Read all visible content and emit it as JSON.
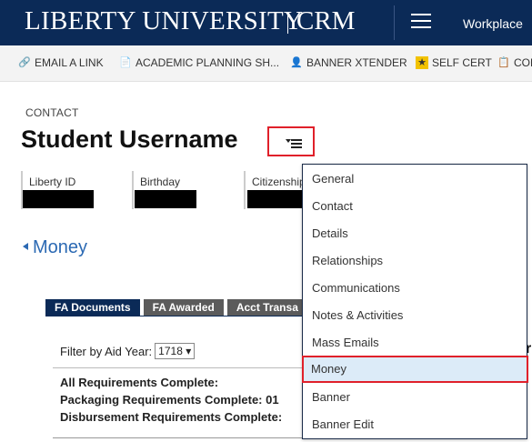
{
  "header": {
    "brand_main": "LIBERTY UNIVERSITY",
    "brand_suffix": "CRM",
    "area_label": "Workplace"
  },
  "command_bar": {
    "items": [
      {
        "label": "EMAIL A LINK",
        "icon": "link-icon"
      },
      {
        "label": "ACADEMIC PLANNING SH...",
        "icon": "document-icon"
      },
      {
        "label": "BANNER XTENDER",
        "icon": "person-icon"
      },
      {
        "label": "SELF CERT",
        "icon": "certificate-icon"
      },
      {
        "label": "COR",
        "icon": "report-icon"
      }
    ]
  },
  "record": {
    "entity": "CONTACT",
    "title": "Student Username"
  },
  "fields": [
    {
      "label": "Liberty ID"
    },
    {
      "label": "Birthday"
    },
    {
      "label": "Citizenship"
    }
  ],
  "section": {
    "title": "Money"
  },
  "tabs": [
    {
      "label": "FA Documents",
      "active": true
    },
    {
      "label": "FA Awarded",
      "active": false
    },
    {
      "label": "Acct Transa",
      "active": false
    }
  ],
  "filter": {
    "label": "Filter by Aid Year:",
    "selected": "1718"
  },
  "requirements": [
    "All Requirements Complete:",
    "Packaging Requirements Complete: 01",
    "Disbursement Requirements Complete:"
  ],
  "stray_char": "r",
  "nav_menu": {
    "items": [
      "General",
      "Contact",
      "Details",
      "Relationships",
      "Communications",
      "Notes & Activities",
      "Mass Emails",
      "Money",
      "Banner",
      "Banner Edit"
    ],
    "selected": "Money"
  },
  "colors": {
    "topbar": "#0b2a57",
    "link": "#2b69b3",
    "highlight_border": "#e0202a",
    "selected_bg": "#dcebf8"
  }
}
